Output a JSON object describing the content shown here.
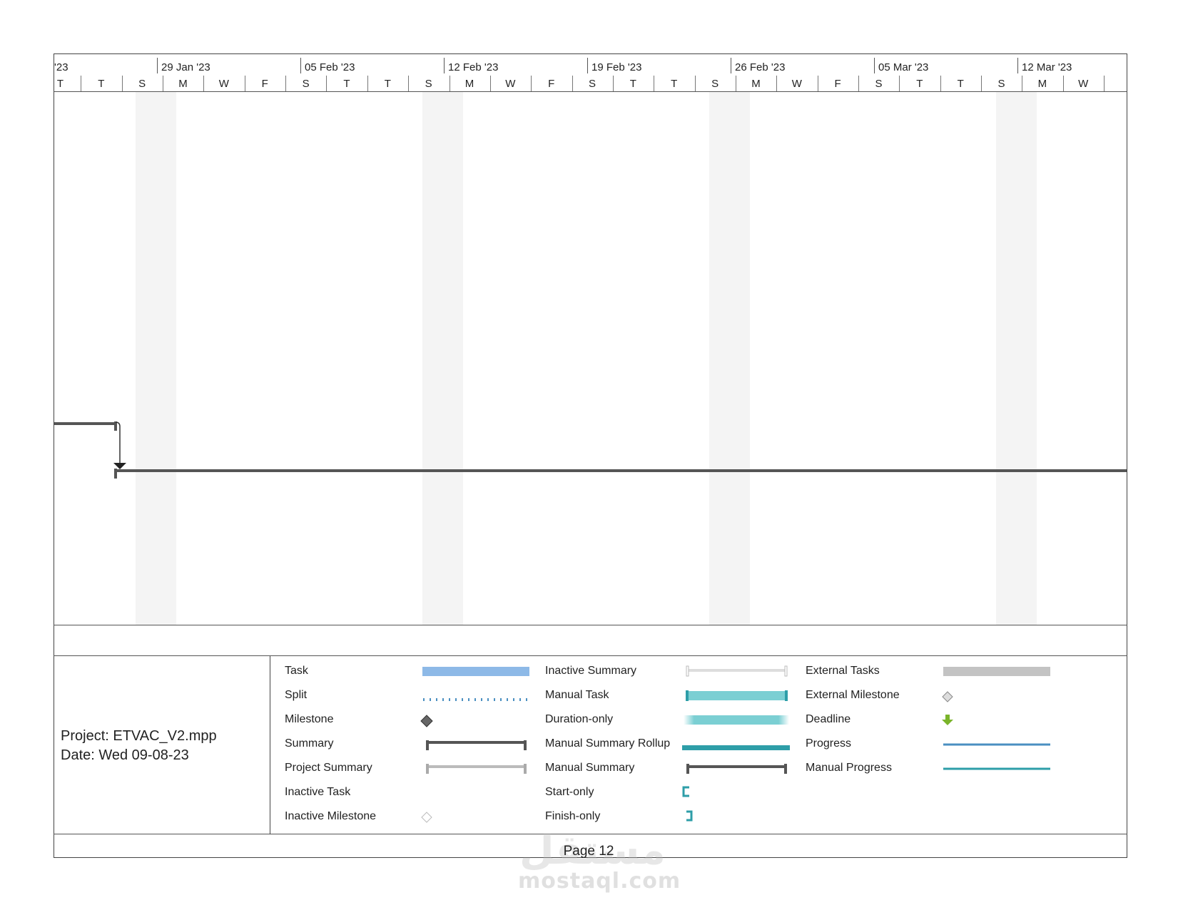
{
  "timescale": {
    "weeks": [
      "'23",
      "29 Jan '23",
      "05 Feb '23",
      "12 Feb '23",
      "19 Feb '23",
      "26 Feb '23",
      "05 Mar '23",
      "12 Mar '23"
    ],
    "days": [
      "T",
      "T",
      "S",
      "M",
      "W",
      "F",
      "S",
      "T",
      "T",
      "S",
      "M",
      "W",
      "F",
      "S",
      "T",
      "T",
      "S",
      "M",
      "W",
      "F",
      "S",
      "T",
      "T",
      "S",
      "M",
      "W"
    ]
  },
  "legend": {
    "col1": [
      "Task",
      "Split",
      "Milestone",
      "Summary",
      "Project Summary",
      "Inactive Task",
      "Inactive Milestone"
    ],
    "col2": [
      "Inactive Summary",
      "Manual Task",
      "Duration-only",
      "Manual Summary Rollup",
      "Manual Summary",
      "Start-only",
      "Finish-only"
    ],
    "col3": [
      "External Tasks",
      "External Milestone",
      "Deadline",
      "Progress",
      "Manual Progress"
    ]
  },
  "footer": {
    "project": "Project: ETVAC_V2.mpp",
    "date": "Date: Wed 09-08-23",
    "page": "Page 12"
  },
  "watermark": {
    "arabic": "مستقل",
    "latin": "mostaql.com"
  },
  "colors": {
    "task": "#8db9e7",
    "manual_task": "#7bcfd3",
    "teal": "#2e9ea8",
    "progress": "#4a8fc1",
    "summary": "#555555",
    "deadline": "#7ab42a"
  }
}
